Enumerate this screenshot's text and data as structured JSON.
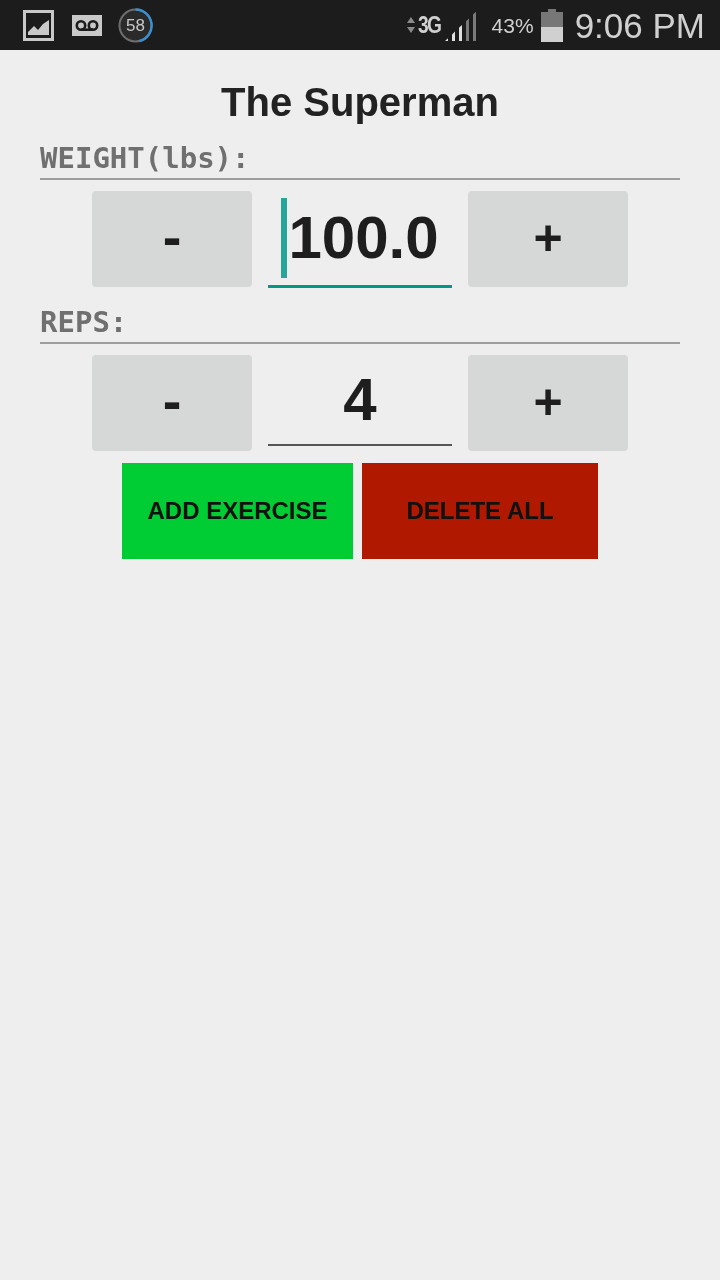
{
  "status_bar": {
    "notification_count": "58",
    "network": "3G",
    "battery_percent": "43%",
    "time": "9:06 PM"
  },
  "title": "The Superman",
  "steppers": [
    {
      "label": "WEIGHT(lbs):",
      "decrement": "-",
      "value": "100.0",
      "increment": "+",
      "focused": true
    },
    {
      "label": "REPS:",
      "decrement": "-",
      "value": "4",
      "increment": "+",
      "focused": false
    }
  ],
  "buttons": [
    {
      "label": "ADD EXERCISE",
      "kind": "add"
    },
    {
      "label": "DELETE ALL",
      "kind": "delete"
    }
  ]
}
